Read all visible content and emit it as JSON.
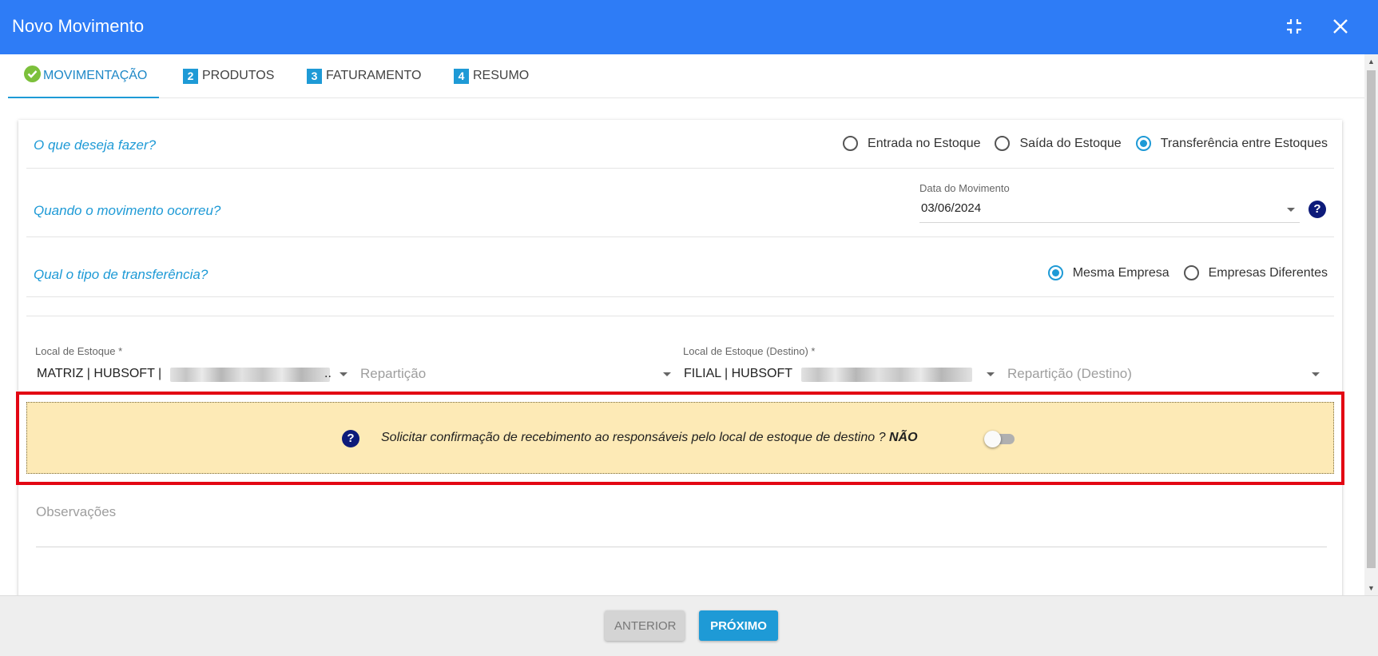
{
  "dialog": {
    "title": "Novo Movimento"
  },
  "tabs": [
    {
      "label": "MOVIMENTAÇÃO",
      "number": "",
      "state": "completed"
    },
    {
      "label": "PRODUTOS",
      "number": "2"
    },
    {
      "label": "FATURAMENTO",
      "number": "3"
    },
    {
      "label": "RESUMO",
      "number": "4"
    }
  ],
  "q1": {
    "question": "O que deseja fazer?",
    "options": [
      "Entrada no Estoque",
      "Saída do Estoque",
      "Transferência entre Estoques"
    ],
    "selected": "Transferência entre Estoques"
  },
  "q2": {
    "question": "Quando o movimento ocorreu?",
    "date_label": "Data do Movimento",
    "date_value": "03/06/2024",
    "help": "?"
  },
  "q3": {
    "question": "Qual o tipo de transferência?",
    "options": [
      "Mesma Empresa",
      "Empresas Diferentes"
    ],
    "selected": "Mesma Empresa"
  },
  "origin": {
    "label": "Local de Estoque *",
    "value": "MATRIZ | HUBSOFT |",
    "suffix": "..",
    "partition_placeholder": "Repartição"
  },
  "destination": {
    "label": "Local de Estoque (Destino) *",
    "value": "FILIAL | HUBSOFT",
    "partition_placeholder": "Repartição (Destino)"
  },
  "confirmation": {
    "help": "?",
    "text": "Solicitar confirmação de recebimento ao responsáveis pelo local de estoque de destino ?",
    "state_label": "NÃO",
    "enabled": false
  },
  "notes": {
    "placeholder": "Observações"
  },
  "footer": {
    "prev_label": "ANTERIOR",
    "next_label": "PRÓXIMO"
  },
  "colors": {
    "header": "#2e7cf6",
    "accent": "#1e9ad6",
    "notice_bg": "#fdeab6",
    "highlight_border": "#e30613"
  }
}
